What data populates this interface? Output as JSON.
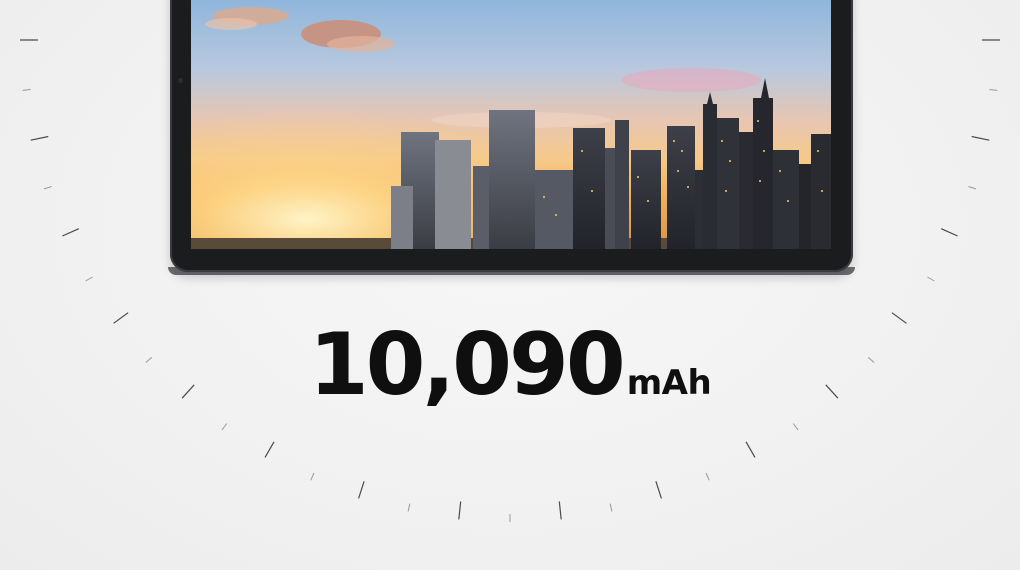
{
  "battery": {
    "capacity_value": "10,090",
    "capacity_unit": "mAh"
  },
  "colors": {
    "background": "#f3f3f3",
    "text": "#0f0f10",
    "tablet_bezel": "#1b1c1e",
    "tick": "#4a4a4a"
  },
  "icons": {
    "camera": "front-camera-dot"
  }
}
